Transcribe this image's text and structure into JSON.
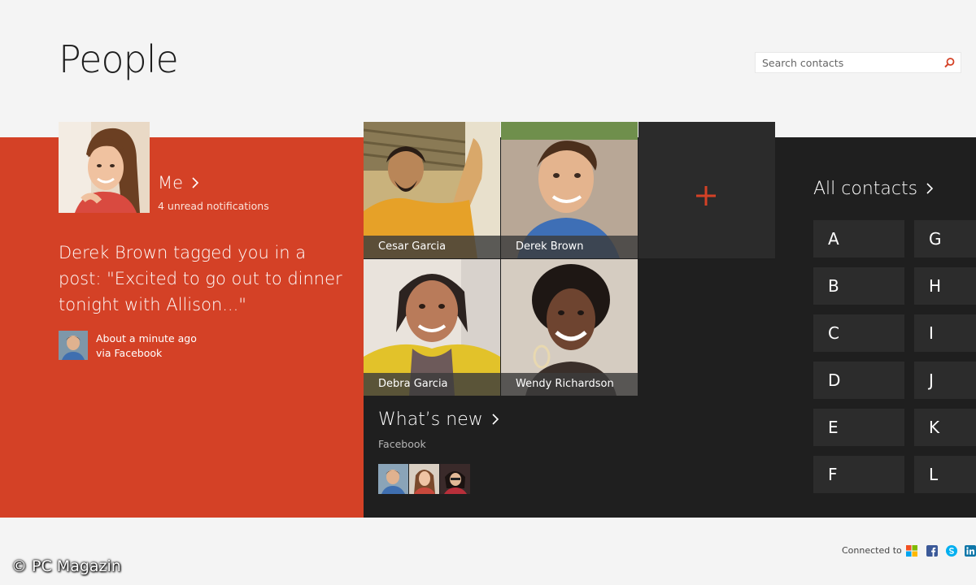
{
  "app": {
    "title": "People"
  },
  "search": {
    "placeholder": "Search contacts"
  },
  "me": {
    "title": "Me",
    "notifications": "4 unread notifications",
    "post": "Derek Brown tagged you in a post: \"Excited to go out to dinner tonight with Allison...\"",
    "post_time": "About a minute ago",
    "post_source": "via Facebook"
  },
  "favorites": [
    {
      "name": "Cesar Garcia"
    },
    {
      "name": "Derek Brown"
    },
    {
      "name": "Debra Garcia"
    },
    {
      "name": "Wendy Richardson"
    }
  ],
  "add_tile": {
    "icon": "plus-icon",
    "color": "#d44126"
  },
  "whats_new": {
    "title": "What’s new",
    "subtitle": "Facebook"
  },
  "all_contacts": {
    "title": "All contacts",
    "letters": [
      "A",
      "B",
      "C",
      "D",
      "E",
      "F",
      "G",
      "H",
      "I",
      "J",
      "K",
      "L"
    ]
  },
  "footer": {
    "connected_label": "Connected to",
    "services": [
      "microsoft-icon",
      "facebook-icon",
      "skype-icon",
      "linkedin-icon"
    ]
  },
  "watermark": "© PC Magazin",
  "colors": {
    "accent": "#d44126",
    "dark": "#1f1f1f",
    "tile": "#2c2c2c",
    "background": "#f4f4f4"
  }
}
